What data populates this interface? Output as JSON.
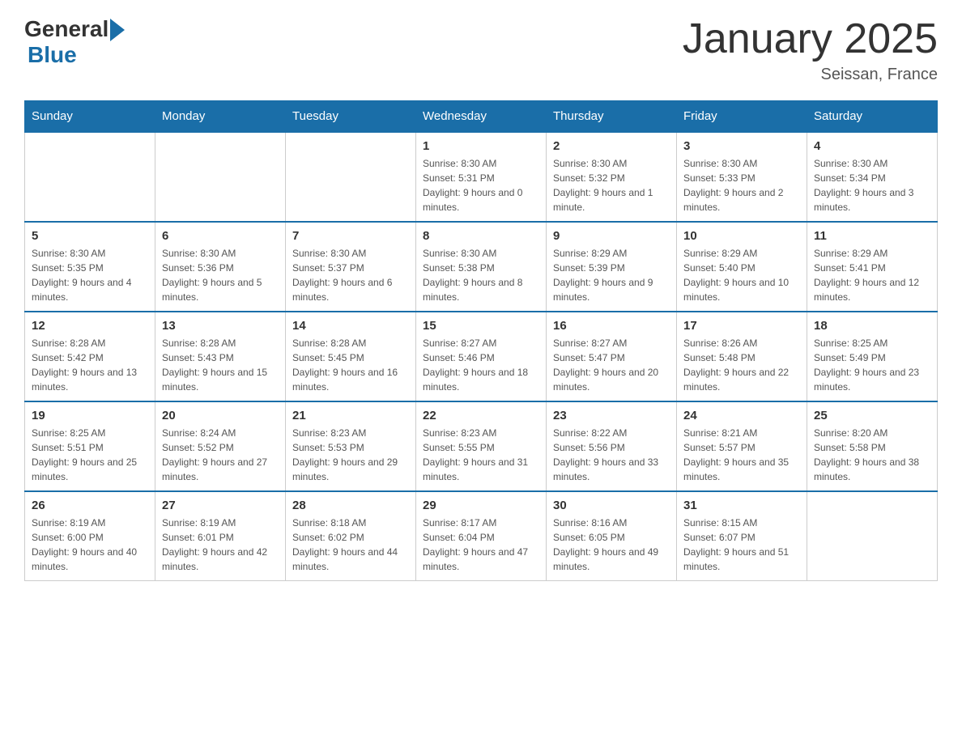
{
  "header": {
    "logo_general": "General",
    "logo_blue": "Blue",
    "title": "January 2025",
    "location": "Seissan, France"
  },
  "days_of_week": [
    "Sunday",
    "Monday",
    "Tuesday",
    "Wednesday",
    "Thursday",
    "Friday",
    "Saturday"
  ],
  "weeks": [
    [
      {
        "day": "",
        "info": ""
      },
      {
        "day": "",
        "info": ""
      },
      {
        "day": "",
        "info": ""
      },
      {
        "day": "1",
        "info": "Sunrise: 8:30 AM\nSunset: 5:31 PM\nDaylight: 9 hours and 0 minutes."
      },
      {
        "day": "2",
        "info": "Sunrise: 8:30 AM\nSunset: 5:32 PM\nDaylight: 9 hours and 1 minute."
      },
      {
        "day": "3",
        "info": "Sunrise: 8:30 AM\nSunset: 5:33 PM\nDaylight: 9 hours and 2 minutes."
      },
      {
        "day": "4",
        "info": "Sunrise: 8:30 AM\nSunset: 5:34 PM\nDaylight: 9 hours and 3 minutes."
      }
    ],
    [
      {
        "day": "5",
        "info": "Sunrise: 8:30 AM\nSunset: 5:35 PM\nDaylight: 9 hours and 4 minutes."
      },
      {
        "day": "6",
        "info": "Sunrise: 8:30 AM\nSunset: 5:36 PM\nDaylight: 9 hours and 5 minutes."
      },
      {
        "day": "7",
        "info": "Sunrise: 8:30 AM\nSunset: 5:37 PM\nDaylight: 9 hours and 6 minutes."
      },
      {
        "day": "8",
        "info": "Sunrise: 8:30 AM\nSunset: 5:38 PM\nDaylight: 9 hours and 8 minutes."
      },
      {
        "day": "9",
        "info": "Sunrise: 8:29 AM\nSunset: 5:39 PM\nDaylight: 9 hours and 9 minutes."
      },
      {
        "day": "10",
        "info": "Sunrise: 8:29 AM\nSunset: 5:40 PM\nDaylight: 9 hours and 10 minutes."
      },
      {
        "day": "11",
        "info": "Sunrise: 8:29 AM\nSunset: 5:41 PM\nDaylight: 9 hours and 12 minutes."
      }
    ],
    [
      {
        "day": "12",
        "info": "Sunrise: 8:28 AM\nSunset: 5:42 PM\nDaylight: 9 hours and 13 minutes."
      },
      {
        "day": "13",
        "info": "Sunrise: 8:28 AM\nSunset: 5:43 PM\nDaylight: 9 hours and 15 minutes."
      },
      {
        "day": "14",
        "info": "Sunrise: 8:28 AM\nSunset: 5:45 PM\nDaylight: 9 hours and 16 minutes."
      },
      {
        "day": "15",
        "info": "Sunrise: 8:27 AM\nSunset: 5:46 PM\nDaylight: 9 hours and 18 minutes."
      },
      {
        "day": "16",
        "info": "Sunrise: 8:27 AM\nSunset: 5:47 PM\nDaylight: 9 hours and 20 minutes."
      },
      {
        "day": "17",
        "info": "Sunrise: 8:26 AM\nSunset: 5:48 PM\nDaylight: 9 hours and 22 minutes."
      },
      {
        "day": "18",
        "info": "Sunrise: 8:25 AM\nSunset: 5:49 PM\nDaylight: 9 hours and 23 minutes."
      }
    ],
    [
      {
        "day": "19",
        "info": "Sunrise: 8:25 AM\nSunset: 5:51 PM\nDaylight: 9 hours and 25 minutes."
      },
      {
        "day": "20",
        "info": "Sunrise: 8:24 AM\nSunset: 5:52 PM\nDaylight: 9 hours and 27 minutes."
      },
      {
        "day": "21",
        "info": "Sunrise: 8:23 AM\nSunset: 5:53 PM\nDaylight: 9 hours and 29 minutes."
      },
      {
        "day": "22",
        "info": "Sunrise: 8:23 AM\nSunset: 5:55 PM\nDaylight: 9 hours and 31 minutes."
      },
      {
        "day": "23",
        "info": "Sunrise: 8:22 AM\nSunset: 5:56 PM\nDaylight: 9 hours and 33 minutes."
      },
      {
        "day": "24",
        "info": "Sunrise: 8:21 AM\nSunset: 5:57 PM\nDaylight: 9 hours and 35 minutes."
      },
      {
        "day": "25",
        "info": "Sunrise: 8:20 AM\nSunset: 5:58 PM\nDaylight: 9 hours and 38 minutes."
      }
    ],
    [
      {
        "day": "26",
        "info": "Sunrise: 8:19 AM\nSunset: 6:00 PM\nDaylight: 9 hours and 40 minutes."
      },
      {
        "day": "27",
        "info": "Sunrise: 8:19 AM\nSunset: 6:01 PM\nDaylight: 9 hours and 42 minutes."
      },
      {
        "day": "28",
        "info": "Sunrise: 8:18 AM\nSunset: 6:02 PM\nDaylight: 9 hours and 44 minutes."
      },
      {
        "day": "29",
        "info": "Sunrise: 8:17 AM\nSunset: 6:04 PM\nDaylight: 9 hours and 47 minutes."
      },
      {
        "day": "30",
        "info": "Sunrise: 8:16 AM\nSunset: 6:05 PM\nDaylight: 9 hours and 49 minutes."
      },
      {
        "day": "31",
        "info": "Sunrise: 8:15 AM\nSunset: 6:07 PM\nDaylight: 9 hours and 51 minutes."
      },
      {
        "day": "",
        "info": ""
      }
    ]
  ]
}
